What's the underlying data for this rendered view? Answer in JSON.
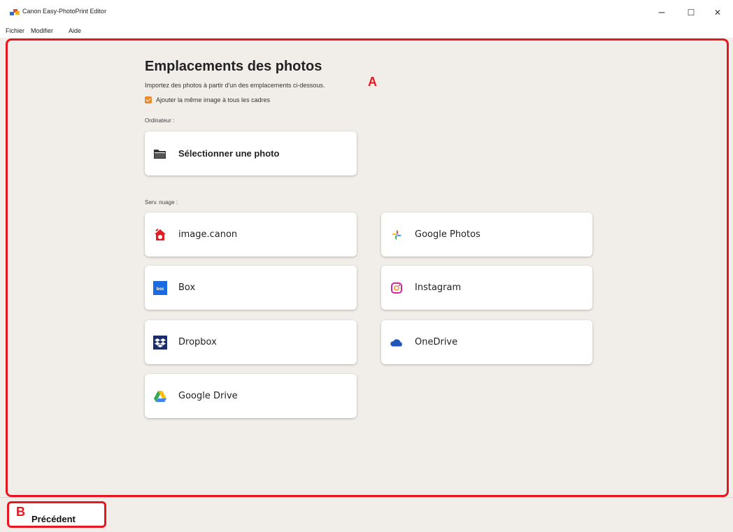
{
  "window": {
    "title": "Canon Easy-PhotoPrint Editor",
    "minimize": "–",
    "maximize": "☐",
    "close": "✕"
  },
  "menu": [
    "Fichier",
    "Modifier",
    "Aide"
  ],
  "annotations": {
    "a": "A",
    "b": "B"
  },
  "main": {
    "heading": "Emplacements des photos",
    "subtitle": "Importez des photos à partir d'un des emplacements ci-dessous.",
    "checkbox_label": "Ajouter la même image à tous les cadres",
    "checkbox_checked": true,
    "computer_label": "Ordinateur :",
    "select_photo": "Sélectionner une photo",
    "cloud_label": "Serv. nuage :",
    "services": [
      {
        "label": "image.canon",
        "icon": "image-canon-icon"
      },
      {
        "label": "Google Photos",
        "icon": "google-photos-icon"
      },
      {
        "label": "Box",
        "icon": "box-icon"
      },
      {
        "label": "Instagram",
        "icon": "instagram-icon"
      },
      {
        "label": "Dropbox",
        "icon": "dropbox-icon"
      },
      {
        "label": "OneDrive",
        "icon": "onedrive-icon"
      },
      {
        "label": "Google Drive",
        "icon": "google-drive-icon"
      }
    ]
  },
  "footer": {
    "back_label": "Précédent"
  },
  "colors": {
    "accent_red": "#e8161f",
    "checkbox": "#e8892e",
    "background": "#f1eee9"
  }
}
